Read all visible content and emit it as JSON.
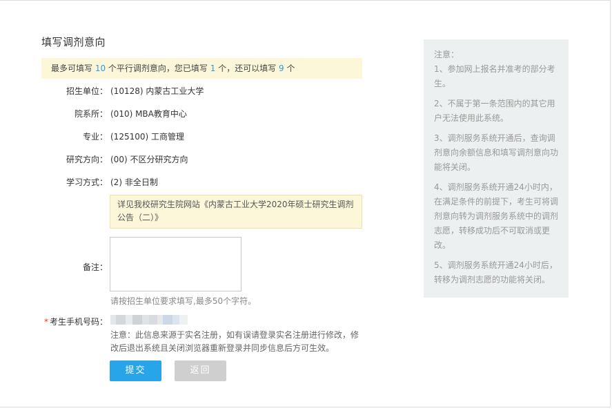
{
  "page": {
    "title": "填写调剂意向"
  },
  "quota": {
    "prefix": "最多可填写 ",
    "max": "10",
    "middle1": " 个平行调剂意向，您已填写 ",
    "filled": "1",
    "middle2": " 个，还可以填写 ",
    "remaining": "9",
    "suffix": " 个"
  },
  "form": {
    "unit_label": "招生单位：",
    "unit_value": "(10128) 内蒙古工业大学",
    "dept_label": "院系所：",
    "dept_value": "(010) MBA教育中心",
    "major_label": "专业：",
    "major_value": "(125100) 工商管理",
    "direction_label": "研究方向：",
    "direction_value": "(00) 不区分研究方向",
    "mode_label": "学习方式：",
    "mode_value": "(2) 非全日制",
    "notice_text": "详见我校研究生院网站《内蒙古工业大学2020年硕士研究生调剂公告（二）》",
    "remark_label": "备注：",
    "remark_value": "",
    "remark_hint": "请按招生单位要求填写,最多50个字符。",
    "phone_star": "*",
    "phone_label": "考生手机号码：",
    "phone_note": "注意：此信息来源于实名注册，如有误请登录实名注册进行修改，修改后退出系统且关闭浏览器重新登录并同步信息后方可生效。",
    "submit_label": "提交",
    "back_label": "返回"
  },
  "side": {
    "title": "注意：",
    "items": [
      "1、参加网上报名并准考的部分考生。",
      "2、不属于第一条范围内的其它用户无法使用此系统。",
      "3、调剂服务系统开通后，查询调剂意向余额信息和填写调剂意向功能将关闭。",
      "4、调剂服务系统开通24小时内，在满足条件的前提下，考生可将调剂意向转为调剂服务系统中的调剂志愿，转移成功后不可取消或更改。",
      "5、调剂服务系统开通24小时后，转移为调剂志愿的功能将关闭。"
    ]
  },
  "colors": {
    "accent": "#27a5e8",
    "highlight_bg": "#fdf7d9",
    "side_bg": "#edf0f0",
    "required": "#ee3333"
  }
}
